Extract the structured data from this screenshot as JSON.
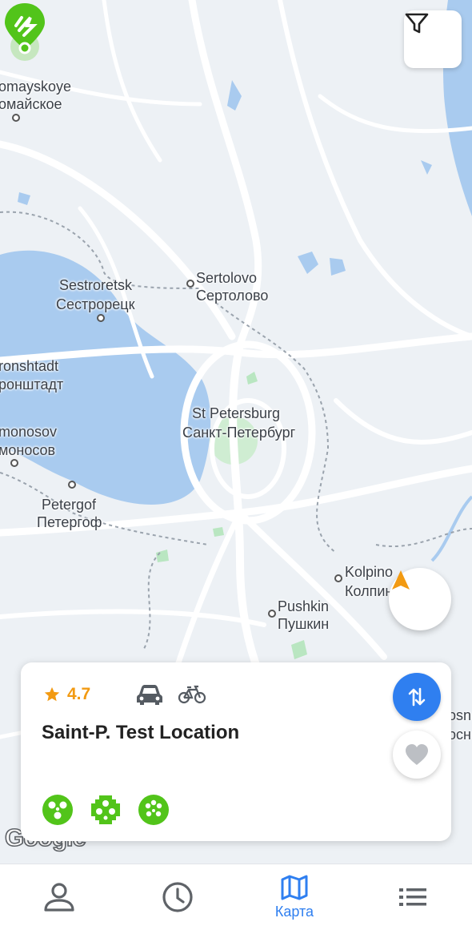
{
  "map": {
    "labels": [
      {
        "id": "pervomayskoye-en",
        "text": "omayskoye"
      },
      {
        "id": "pervomayskoye-ru",
        "text": "омайское"
      },
      {
        "id": "sertolovo-en",
        "text": "Sertolovo"
      },
      {
        "id": "sertolovo-ru",
        "text": "Сертолово"
      },
      {
        "id": "sestroretsk-en",
        "text": "Sestroretsk"
      },
      {
        "id": "sestroretsk-ru",
        "text": "Сестрорецк"
      },
      {
        "id": "kronshtadt-en",
        "text": "ronshtadt"
      },
      {
        "id": "kronshtadt-ru",
        "text": "ронштадт"
      },
      {
        "id": "lomonosov-en",
        "text": "monosov"
      },
      {
        "id": "lomonosov-ru",
        "text": "моносов"
      },
      {
        "id": "spb-en",
        "text": "St Petersburg"
      },
      {
        "id": "spb-ru",
        "text": "Санкт-Петербург"
      },
      {
        "id": "peterhof-en",
        "text": "Petergof"
      },
      {
        "id": "peterhof-ru",
        "text": "Петергоф"
      },
      {
        "id": "kolpino-en",
        "text": "Kolpino"
      },
      {
        "id": "kolpino-ru",
        "text": "Колпино"
      },
      {
        "id": "pushkin-en",
        "text": "Pushkin"
      },
      {
        "id": "pushkin-ru",
        "text": "Пушкин"
      },
      {
        "id": "edge-en",
        "text": "osn"
      },
      {
        "id": "edge-ru",
        "text": "осн"
      }
    ],
    "attribution": "Google",
    "colors": {
      "water": "#a9cbef",
      "land": "#edf1f5",
      "road": "#ffffff",
      "park": "#b9e6c1"
    }
  },
  "controls": {
    "filter_icon": "funnel-icon",
    "locate_icon": "navigation-arrow-icon"
  },
  "marker": {
    "icon": "charging-station-icon",
    "color": "#52c41a"
  },
  "card": {
    "rating": "4.7",
    "rating_icon": "star-icon",
    "vehicle_icons": [
      "car-icon",
      "bicycle-icon"
    ],
    "title": "Saint-P. Test Location",
    "route_icon": "swap-arrows-icon",
    "favorite_icon": "heart-icon",
    "connectors": [
      "connector-type-a-icon",
      "connector-type-b-icon",
      "connector-type-c-icon"
    ],
    "accent": "#2f7ff0",
    "connector_color": "#52c41a",
    "star_color": "#f29a12"
  },
  "navbar": {
    "items": [
      {
        "id": "profile",
        "icon": "user-icon",
        "label": ""
      },
      {
        "id": "history",
        "icon": "clock-icon",
        "label": ""
      },
      {
        "id": "map",
        "icon": "map-icon",
        "label": "Карта",
        "active": true
      },
      {
        "id": "list",
        "icon": "list-icon",
        "label": ""
      }
    ]
  }
}
